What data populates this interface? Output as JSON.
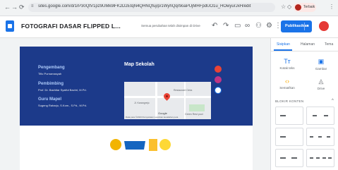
{
  "browser": {
    "back": "←",
    "forward": "→",
    "reload": "⟳",
    "url": "sites.google.com/d/1rP30QtV1pz9UMk9lFK2D2EtqN4QHNQfuj/p/1WyhQqr9oaPUjMHFpdUO1u_HOwyurJxH/edit",
    "star": "☆",
    "profile_label": "Terbaik"
  },
  "app": {
    "doc_title": "FOTOGRAFI DASAR FLIPPED L...",
    "save_note": "Semua perubahan telah disimpan di Drive",
    "publish_label": "Publikasikan",
    "publish_dropdown": "▾",
    "toolbar_icons": [
      "undo-icon",
      "redo-icon",
      "preview-icon",
      "link-icon",
      "share-icon",
      "settings-icon",
      "more-icon"
    ]
  },
  "page": {
    "pengembang": {
      "title": "Pengembang",
      "name": "Tiflo Purnamasyah"
    },
    "pembimbing": {
      "title": "Pembimbing",
      "name": "Prof. Dr. Bachtiar Syaiful Bachri, M.Pd."
    },
    "guru": {
      "title": "Guru Mapel",
      "name": "Sugeng Raharjo, S.Kom., S.Pd., M.Pd."
    },
    "map_title": "Map Sekolah",
    "map_labels": {
      "place": "Restaurant Cinta",
      "street": "Jl. Karangrejo",
      "park": "Green Rest pool",
      "google": "Google",
      "footer": "Data peta ©2023   Persyaratan   Laporkan kesalahan peta"
    }
  },
  "panel": {
    "tabs": [
      "Sisipkan",
      "Halaman",
      "Tema"
    ],
    "items": [
      {
        "icon": "Tт",
        "label": "Kotak teks"
      },
      {
        "icon": "▣",
        "label": "Gambar"
      },
      {
        "icon": "‹›",
        "label": "Semat/kan"
      },
      {
        "icon": "◬",
        "label": "Drive"
      }
    ],
    "section_label": "BLOKIR KONTEN",
    "section_chevron": "^"
  },
  "colors": {
    "band": "#1c3a8a",
    "accent": "#1a73e8"
  }
}
